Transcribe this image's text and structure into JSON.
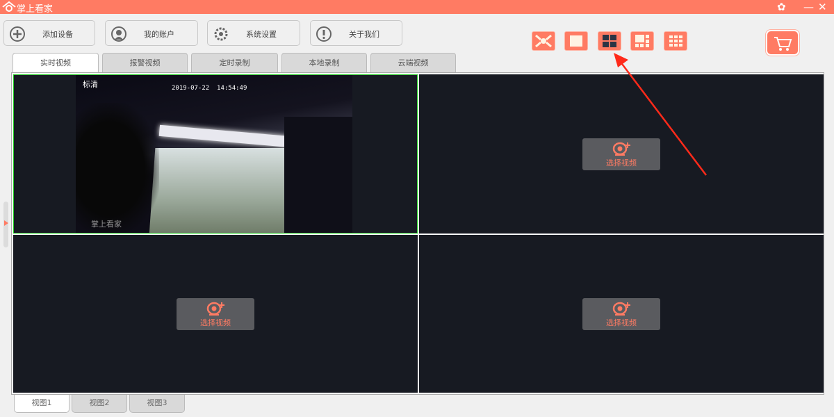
{
  "window": {
    "title": "掌上看家",
    "controls": [
      "skin",
      "minimize",
      "close"
    ]
  },
  "toolbar": [
    {
      "label": "添加设备",
      "icon": "plus-circle-icon"
    },
    {
      "label": "我的账户",
      "icon": "user-icon"
    },
    {
      "label": "系统设置",
      "icon": "gear-icon"
    },
    {
      "label": "关于我们",
      "icon": "info-icon"
    }
  ],
  "tabs": [
    {
      "label": "实时视频",
      "active": true
    },
    {
      "label": "报警视频"
    },
    {
      "label": "定时录制"
    },
    {
      "label": "本地录制"
    },
    {
      "label": "云端视频"
    }
  ],
  "layouts": [
    {
      "name": "fullscreen"
    },
    {
      "name": "single"
    },
    {
      "name": "quad",
      "active": true
    },
    {
      "name": "six"
    },
    {
      "name": "nine"
    }
  ],
  "cart": {
    "icon": "cart-icon"
  },
  "cells": [
    {
      "quality": "标清",
      "timestamp": "2019-07-22  14:54:49",
      "watermark": "掌上看家",
      "selected": true
    },
    {
      "button": "选择视频"
    },
    {
      "button": "选择视频"
    },
    {
      "button": "选择视频"
    }
  ],
  "view_tabs": [
    {
      "label": "视图1",
      "active": true
    },
    {
      "label": "视图2"
    },
    {
      "label": "视图3"
    }
  ],
  "colors": {
    "accent": "#ff7b63",
    "cell_bg": "#171a22",
    "selected": "#22cc22",
    "arrow": "#ff2a1a"
  }
}
